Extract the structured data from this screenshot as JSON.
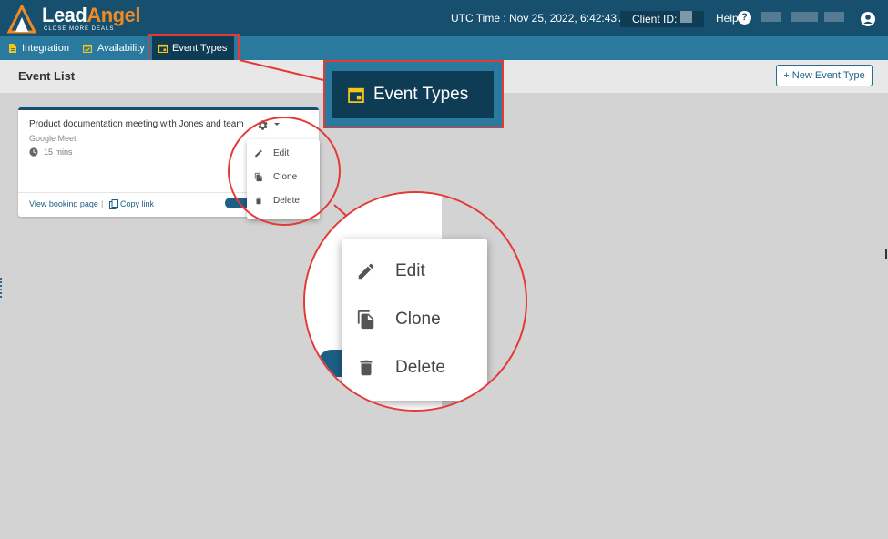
{
  "header": {
    "logo_lead": "Lead",
    "logo_angel": "Angel",
    "logo_tagline": "CLOSE MORE DEALS",
    "utc_time": "UTC Time : Nov 25, 2022, 6:42:43 AM",
    "client_id_label": "Client ID:",
    "help_label": "Help",
    "help_icon_glyph": "?"
  },
  "nav": {
    "items": [
      {
        "label": "Integration",
        "icon": "document-icon"
      },
      {
        "label": "Availability",
        "icon": "calendar-check-icon"
      },
      {
        "label": "Event Types",
        "icon": "calendar-icon",
        "active": true
      }
    ]
  },
  "page": {
    "title": "Event List",
    "new_button_label": "+ New Event Type"
  },
  "event_card": {
    "title": "Product documentation meeting with Jones and team",
    "location": "Google Meet",
    "duration": "15 mins",
    "view_booking_label": "View booking page",
    "separator": "|",
    "copy_link_label": "Copy link"
  },
  "menu": {
    "items": [
      {
        "label": "Edit",
        "icon": "pencil-icon"
      },
      {
        "label": "Clone",
        "icon": "clone-icon"
      },
      {
        "label": "Delete",
        "icon": "trash-icon"
      }
    ]
  },
  "zoom_nav": {
    "label": "Event Types"
  },
  "colors": {
    "header_bg": "#174f6e",
    "nav_bg": "#2a7aa0",
    "nav_active": "#0f3c55",
    "accent_orange": "#f08a24",
    "icon_yellow": "#f5c518",
    "highlight_red": "#e53935"
  }
}
